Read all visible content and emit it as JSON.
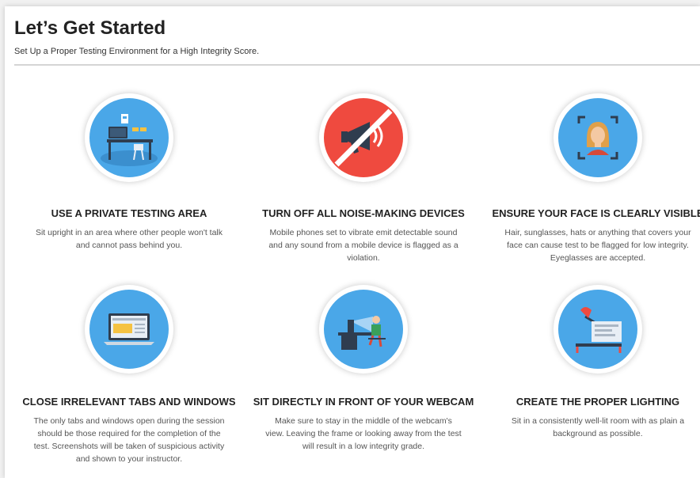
{
  "page": {
    "title": "Let’s Get Started",
    "subtitle": "Set Up a Proper Testing Environment for a High Integrity Score."
  },
  "colors": {
    "blue_circle": "#4aa7e8",
    "red_circle": "#ef4a3f",
    "desk_dark": "#2f3d4f",
    "accent_yellow": "#f5c242"
  },
  "steps": [
    {
      "icon": "private-area-icon",
      "heading": "USE A PRIVATE TESTING AREA",
      "description": "Sit upright in an area where other people won't talk and cannot pass behind you."
    },
    {
      "icon": "no-noise-icon",
      "heading": "TURN OFF ALL NOISE-MAKING DEVICES",
      "description": "Mobile phones set to vibrate emit detectable sound and any sound from a mobile device is flagged as a violation."
    },
    {
      "icon": "face-visible-icon",
      "heading": "ENSURE YOUR FACE IS CLEARLY VISIBLE",
      "description": "Hair, sunglasses, hats or anything that covers your face can cause test to be flagged for low integrity. Eyeglasses are accepted."
    },
    {
      "icon": "close-tabs-icon",
      "heading": "CLOSE IRRELEVANT TABS AND WINDOWS",
      "description": "The only tabs and windows open during the session should be those required for the completion of the test. Screenshots will be taken of suspicious activity and shown to your instructor."
    },
    {
      "icon": "webcam-position-icon",
      "heading": "SIT DIRECTLY IN FRONT OF YOUR WEBCAM",
      "description": "Make sure to stay in the middle of the webcam's view. Leaving the frame or looking away from the test will result in a low integrity grade."
    },
    {
      "icon": "lighting-icon",
      "heading": "CREATE THE PROPER LIGHTING",
      "description": "Sit in a consistently well-lit room with as plain a background as possible."
    }
  ]
}
